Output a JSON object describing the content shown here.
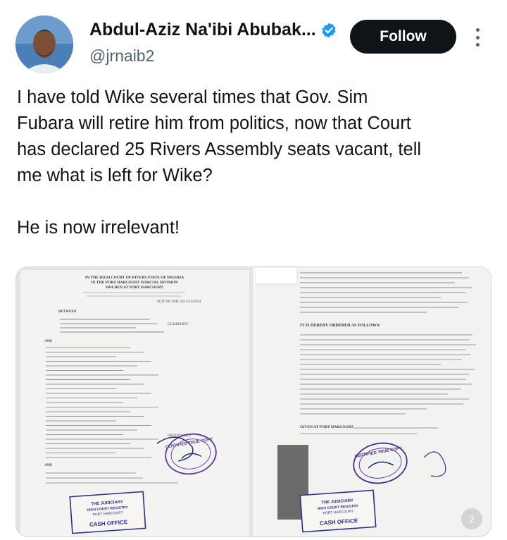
{
  "author": {
    "display_name": "Abdul-Aziz Na'ibi Abubak...",
    "handle": "@jrnaib2",
    "avatar_icon": "profile-photo",
    "verified_icon": "verified-badge-icon",
    "verified_color": "#1d9bf0"
  },
  "actions": {
    "follow_label": "Follow",
    "more_icon": "more-vertical-icon"
  },
  "tweet": {
    "lines": [
      "I have told Wike several times that Gov. Sim",
      "Fubara will retire him from politics, now that Court",
      "has declared 25 Rivers Assembly seats vacant, tell",
      "me what is left for Wike?"
    ],
    "closing": "He is now irrelevant!"
  },
  "media": {
    "count": 2,
    "counter_label": "2",
    "photos": [
      {
        "name": "court-document-page-1",
        "court_header": [
          "IN THE HIGH COURT OF RIVERS STATE OF NIGERIA",
          "IN THE PORT HARCOURT JUDICIAL DIVISION",
          "HOLDEN AT PORT HARCOURT"
        ],
        "suit_no": "SUIT NO: PHC/1512/CS/2024",
        "between": "BETWEEN",
        "claimants_label": "CLAIMANTS",
        "and_label": "AND",
        "defendants_label": "DEFENDANTS",
        "stamp_text": "CERTIFIED TRUE COPY",
        "seal_text": "THE JUDICIARY HIGH COURT REGISTRY PORT HARCOURT CASH OFFICE"
      },
      {
        "name": "court-document-page-2",
        "order_heading": "IT IS HEREBY ORDERED AS FOLLOWS:",
        "given_text": "GIVEN AT PORT HARCOURT",
        "stamp_text": "CERTIFIED TRUE COPY",
        "seal_text": "THE JUDICIARY HIGH COURT REGISTRY PORT HARCOURT CASH OFFICE"
      }
    ]
  }
}
